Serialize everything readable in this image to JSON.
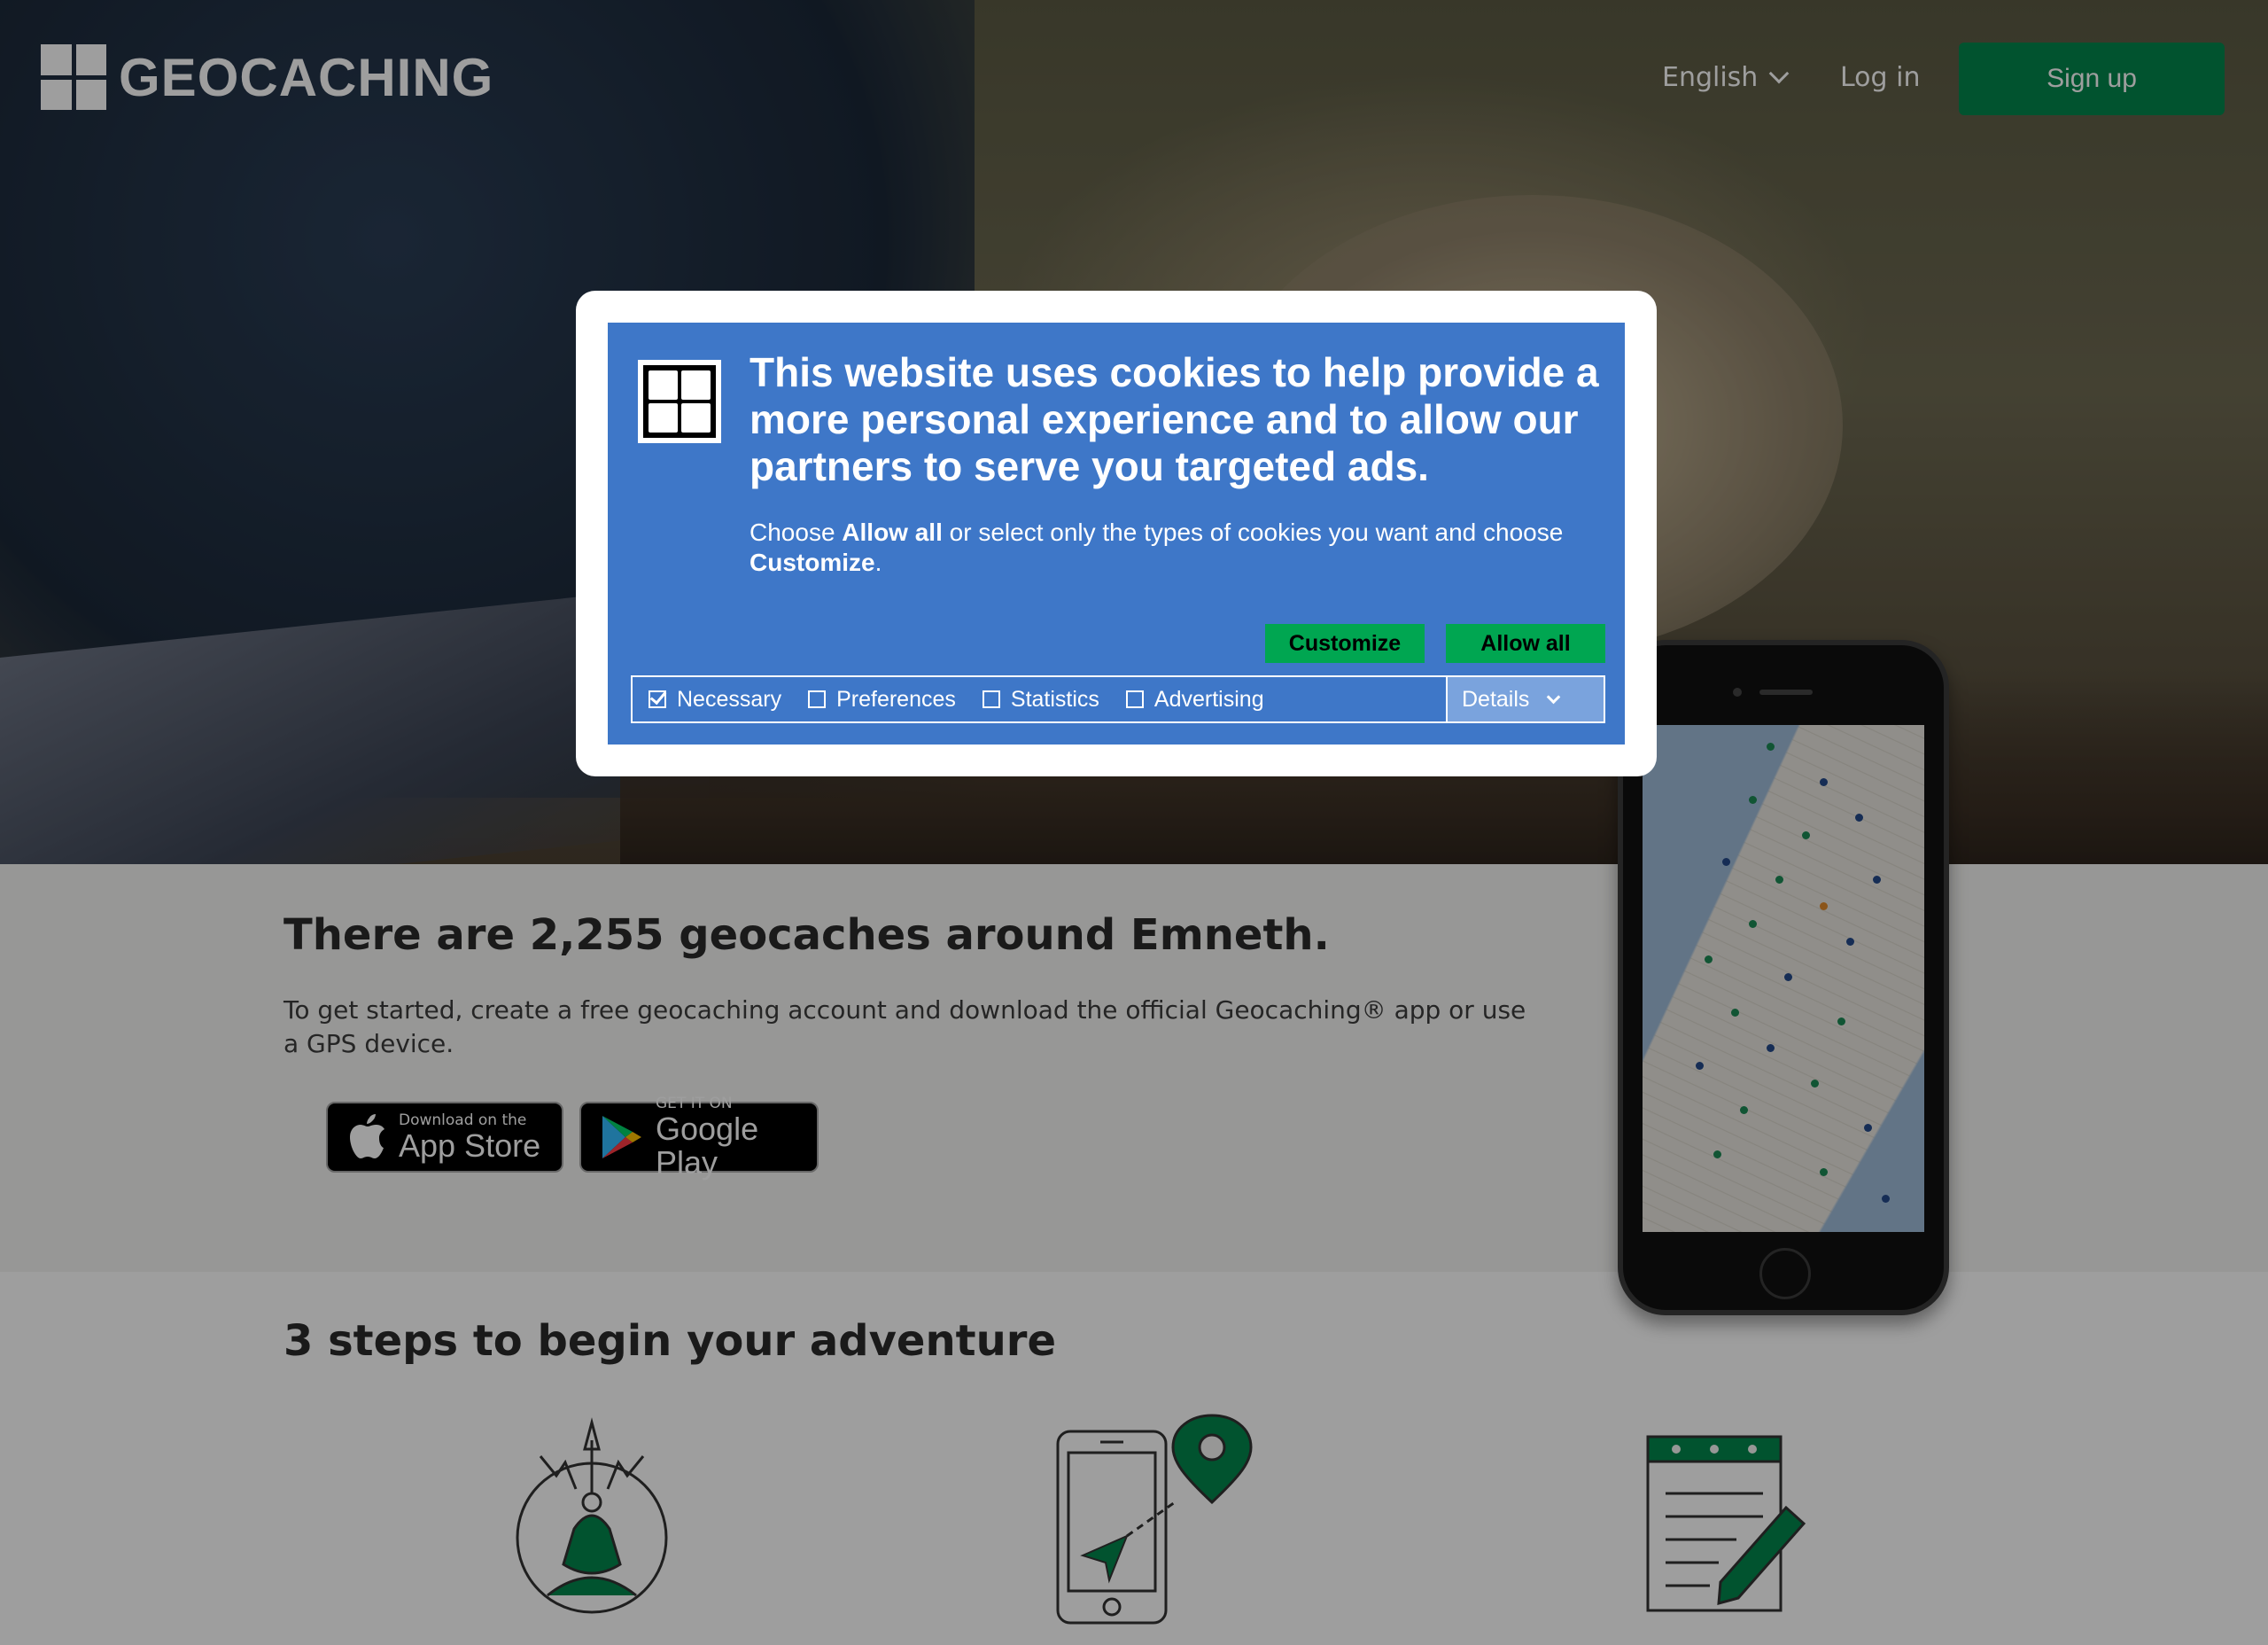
{
  "header": {
    "logo_text": "GEOCACHING",
    "language": "English",
    "login": "Log in",
    "signup": "Sign up"
  },
  "info": {
    "headline": "There are 2,255 geocaches around Emneth.",
    "subtext": "To get started, create a free geocaching account and download the official Geocaching® app or use a GPS device.",
    "app_store": {
      "small": "Download on the",
      "big": "App Store"
    },
    "google_play": {
      "small": "GET IT ON",
      "big": "Google Play"
    }
  },
  "steps": {
    "title": "3 steps to begin your adventure"
  },
  "cookie_banner": {
    "title": "This website uses cookies to help provide a more personal experience and to allow our partners to serve you targeted ads.",
    "text_1": "Choose ",
    "text_allow": "Allow all",
    "text_2": " or select only the types of cookies you want and choose ",
    "text_customize": "Customize",
    "text_3": ".",
    "customize_button": "Customize",
    "allow_all_button": "Allow all",
    "options": [
      {
        "label": "Necessary",
        "checked": true
      },
      {
        "label": "Preferences",
        "checked": false
      },
      {
        "label": "Statistics",
        "checked": false
      },
      {
        "label": "Advertising",
        "checked": false
      }
    ],
    "details": "Details"
  },
  "colors": {
    "brand_green": "#02874d",
    "cookie_blue": "#3e77c8",
    "cookie_button_green": "#00a651"
  }
}
